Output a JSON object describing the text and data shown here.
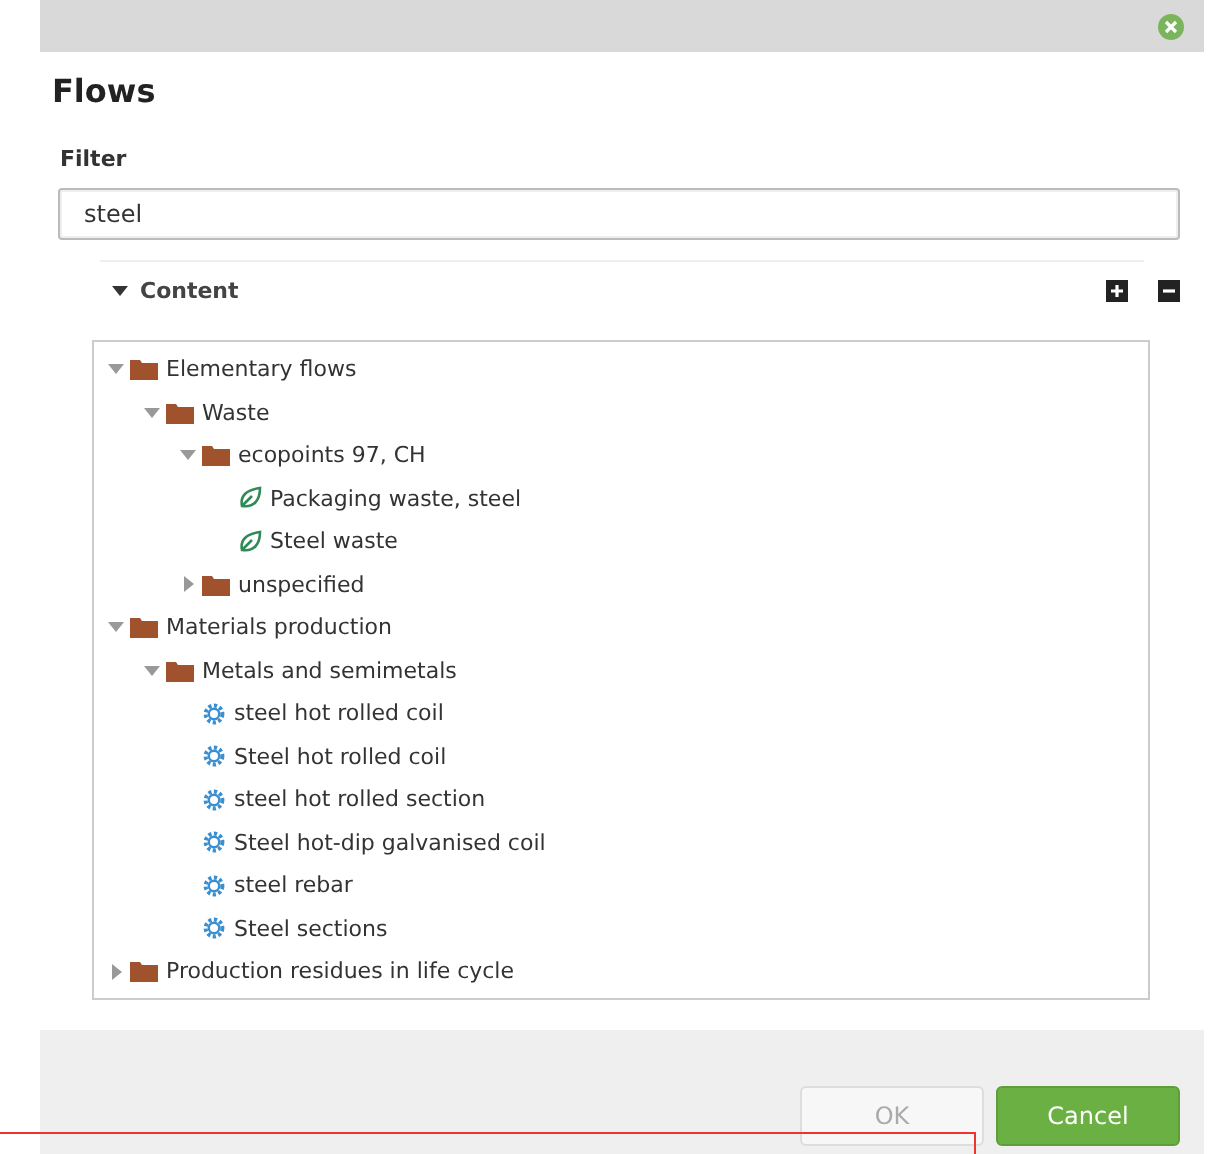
{
  "window": {
    "title": "Flows"
  },
  "filter": {
    "label": "Filter",
    "value": "steel"
  },
  "content": {
    "label": "Content",
    "expanded": true
  },
  "tree": [
    {
      "kind": "folder",
      "label": "Elementary flows",
      "expanded": true,
      "children": [
        {
          "kind": "folder",
          "label": "Waste",
          "expanded": true,
          "children": [
            {
              "kind": "folder",
              "label": "ecopoints 97, CH",
              "expanded": true,
              "children": [
                {
                  "kind": "flow",
                  "label": "Packaging waste, steel"
                },
                {
                  "kind": "flow",
                  "label": "Steel waste"
                }
              ]
            },
            {
              "kind": "folder",
              "label": "unspecified",
              "expanded": false
            }
          ]
        }
      ]
    },
    {
      "kind": "folder",
      "label": "Materials production",
      "expanded": true,
      "children": [
        {
          "kind": "folder",
          "label": "Metals and semimetals",
          "expanded": true,
          "children": [
            {
              "kind": "process",
              "label": "steel hot rolled coil"
            },
            {
              "kind": "process",
              "label": "Steel hot rolled coil"
            },
            {
              "kind": "process",
              "label": "steel hot rolled section"
            },
            {
              "kind": "process",
              "label": "Steel hot-dip galvanised coil"
            },
            {
              "kind": "process",
              "label": "steel rebar"
            },
            {
              "kind": "process",
              "label": "Steel sections"
            }
          ]
        }
      ]
    },
    {
      "kind": "folder",
      "label": "Production residues in life cycle",
      "expanded": false
    }
  ],
  "buttons": [
    {
      "label": "OK",
      "disabled": true
    },
    {
      "label": "Cancel",
      "disabled": false
    }
  ]
}
